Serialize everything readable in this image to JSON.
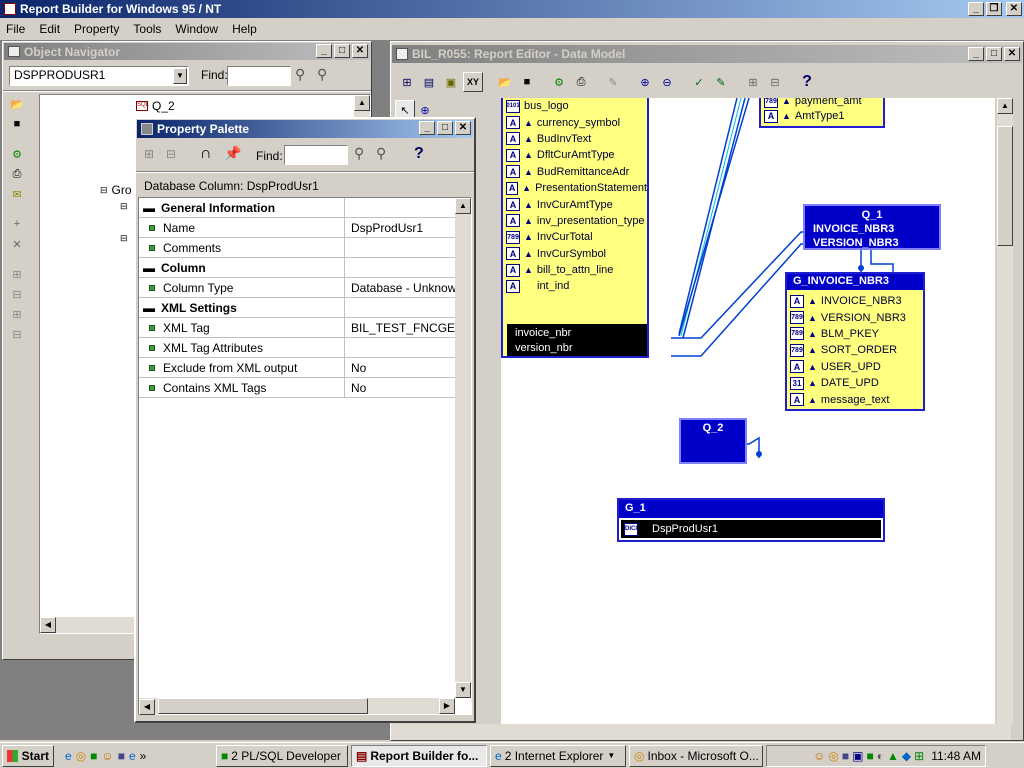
{
  "app": {
    "title": "Report Builder for Windows 95 / NT",
    "menu": [
      "File",
      "Edit",
      "Property",
      "Tools",
      "Window",
      "Help"
    ]
  },
  "navigator": {
    "title": "Object Navigator",
    "combo_value": "DSPPRODUSR1",
    "find_label": "Find:",
    "tree_items": [
      "Q_2",
      "Gro"
    ]
  },
  "palette": {
    "title": "Property Palette",
    "find_label": "Find:",
    "subtitle": "Database Column: DspProdUsr1",
    "sections": [
      {
        "name": "General Information",
        "rows": [
          {
            "k": "Name",
            "v": "DspProdUsr1"
          },
          {
            "k": "Comments",
            "v": ""
          }
        ]
      },
      {
        "name": "Column",
        "rows": [
          {
            "k": "Column Type",
            "v": "Database - Unknown"
          }
        ]
      },
      {
        "name": "XML Settings",
        "rows": [
          {
            "k": "XML Tag",
            "v": "BIL_TEST_FNCGETU"
          },
          {
            "k": "XML Tag Attributes",
            "v": ""
          },
          {
            "k": "Exclude from XML output",
            "v": "No"
          },
          {
            "k": "Contains XML Tags",
            "v": "No"
          }
        ]
      }
    ]
  },
  "editor": {
    "title": "BIL_R055: Report Editor - Data Model",
    "left_group": {
      "rows": [
        {
          "icon": "0101",
          "label": "bus_logo"
        },
        {
          "icon": "A",
          "label": "currency_symbol"
        },
        {
          "icon": "A",
          "label": "BudInvText"
        },
        {
          "icon": "A",
          "label": "DfltCurAmtType"
        },
        {
          "icon": "A",
          "label": "BudRemittanceAdr"
        },
        {
          "icon": "A",
          "label": "PresentationStatement"
        },
        {
          "icon": "A",
          "label": "InvCurAmtType"
        },
        {
          "icon": "A",
          "label": "inv_presentation_type"
        },
        {
          "icon": "789",
          "label": "InvCurTotal"
        },
        {
          "icon": "A",
          "label": "InvCurSymbol"
        },
        {
          "icon": "A",
          "label": "bill_to_attn_line"
        },
        {
          "icon": "A",
          "label": "int_ind"
        }
      ],
      "links": [
        "invoice_nbr",
        "version_nbr"
      ]
    },
    "top_right_group": {
      "rows": [
        {
          "icon": "789",
          "label": "payment_amt"
        },
        {
          "icon": "A",
          "label": "AmtType1"
        }
      ]
    },
    "q1": {
      "name": "Q_1",
      "cols": [
        "INVOICE_NBR3",
        "VERSION_NBR3"
      ]
    },
    "g_invoice": {
      "name": "G_INVOICE_NBR3",
      "rows": [
        {
          "icon": "A",
          "label": "INVOICE_NBR3"
        },
        {
          "icon": "789",
          "label": "VERSION_NBR3"
        },
        {
          "icon": "789",
          "label": "BLM_PKEY"
        },
        {
          "icon": "789",
          "label": "SORT_ORDER"
        },
        {
          "icon": "A",
          "label": "USER_UPD"
        },
        {
          "icon": "31",
          "label": "DATE_UPD"
        },
        {
          "icon": "A",
          "label": "message_text"
        }
      ]
    },
    "q2": {
      "name": "Q_2"
    },
    "g1": {
      "name": "G_1",
      "row": "DspProdUsr1"
    }
  },
  "taskbar": {
    "start": "Start",
    "tasks": [
      "2 PL/SQL Developer",
      "Report Builder fo...",
      "2 Internet Explorer",
      "Inbox - Microsoft O..."
    ],
    "clock": "11:48 AM"
  }
}
